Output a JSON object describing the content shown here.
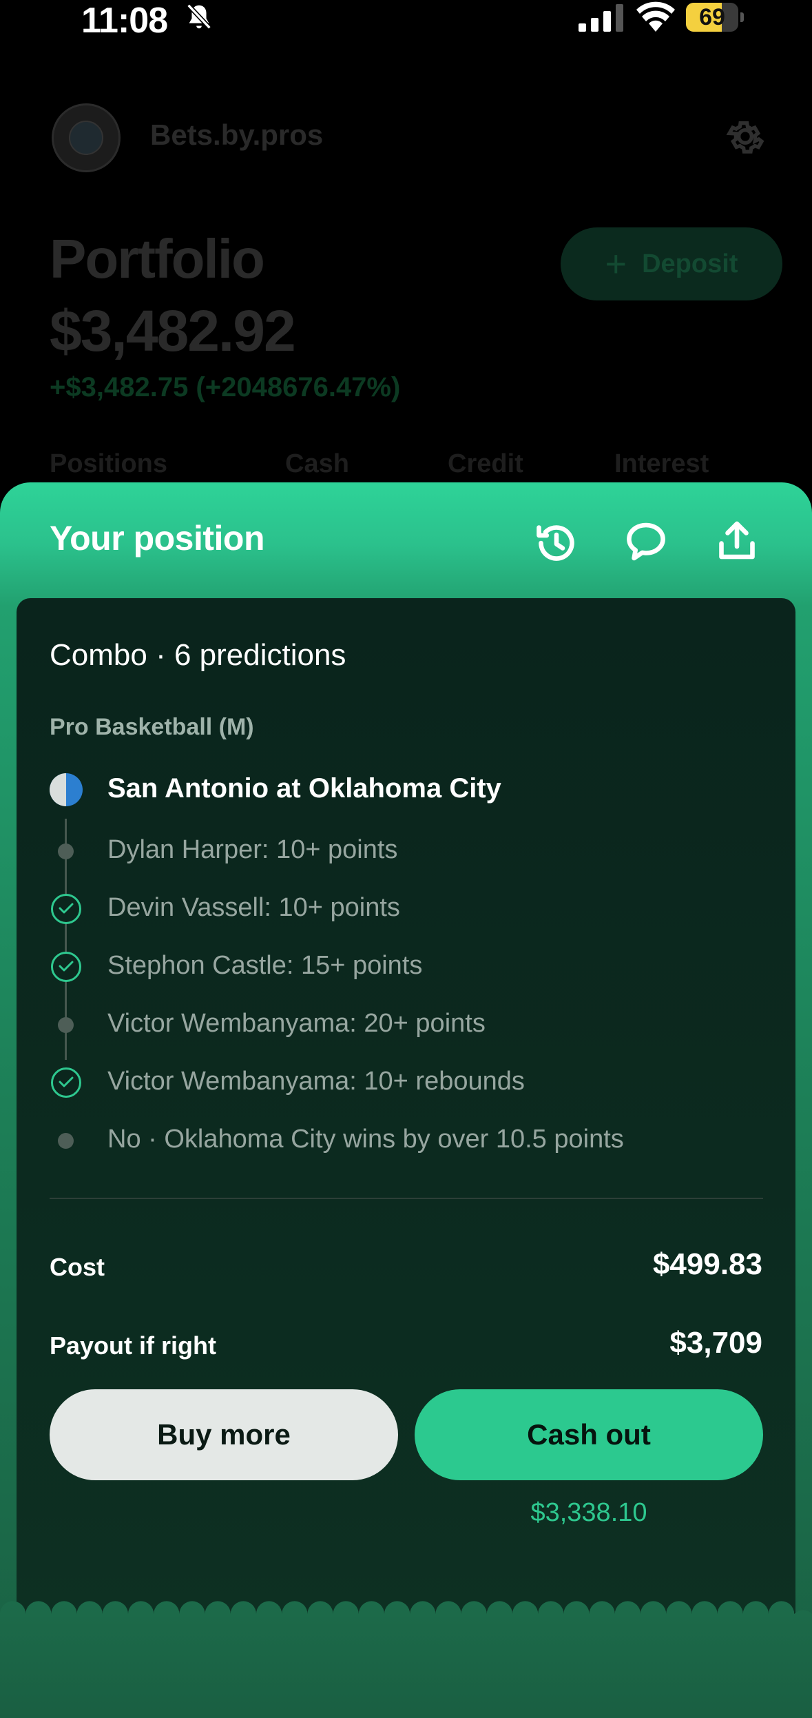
{
  "status_bar": {
    "time": "11:08",
    "battery": "69",
    "battery_level": 0.69,
    "battery_color": "#f4d03f"
  },
  "background": {
    "app_name": "Bets.by.pros",
    "portfolio_label": "Portfolio",
    "portfolio_value": "$3,482.92",
    "portfolio_change": "+$3,482.75 (+2048676.47%)",
    "deposit_label": "Deposit",
    "tabs": [
      "Positions",
      "Cash",
      "Credit",
      "Interest"
    ]
  },
  "sheet": {
    "title": "Your position",
    "icons": [
      "history-icon",
      "chat-icon",
      "share-icon"
    ]
  },
  "position": {
    "combo_title": "Combo · 6 predictions",
    "league": "Pro Basketball (M)",
    "game": "San Antonio at Oklahoma City",
    "legs": [
      {
        "label": "Dylan Harper: 10+ points",
        "status": "pending"
      },
      {
        "label": "Devin Vassell: 10+ points",
        "status": "won"
      },
      {
        "label": "Stephon Castle: 15+ points",
        "status": "won"
      },
      {
        "label": "Victor Wembanyama: 20+ points",
        "status": "pending"
      },
      {
        "label": "Victor Wembanyama: 10+ rebounds",
        "status": "won"
      },
      {
        "label": "No · Oklahoma City wins by over 10.5 points",
        "status": "pending"
      }
    ],
    "cost_label": "Cost",
    "cost_value": "$499.83",
    "payout_label": "Payout if right",
    "payout_value": "$3,709",
    "buy_more_label": "Buy more",
    "cash_out_label": "Cash out",
    "cash_out_value": "$3,338.10"
  },
  "colors": {
    "accent": "#2cc98f",
    "card_background": "#0c2a1f"
  }
}
